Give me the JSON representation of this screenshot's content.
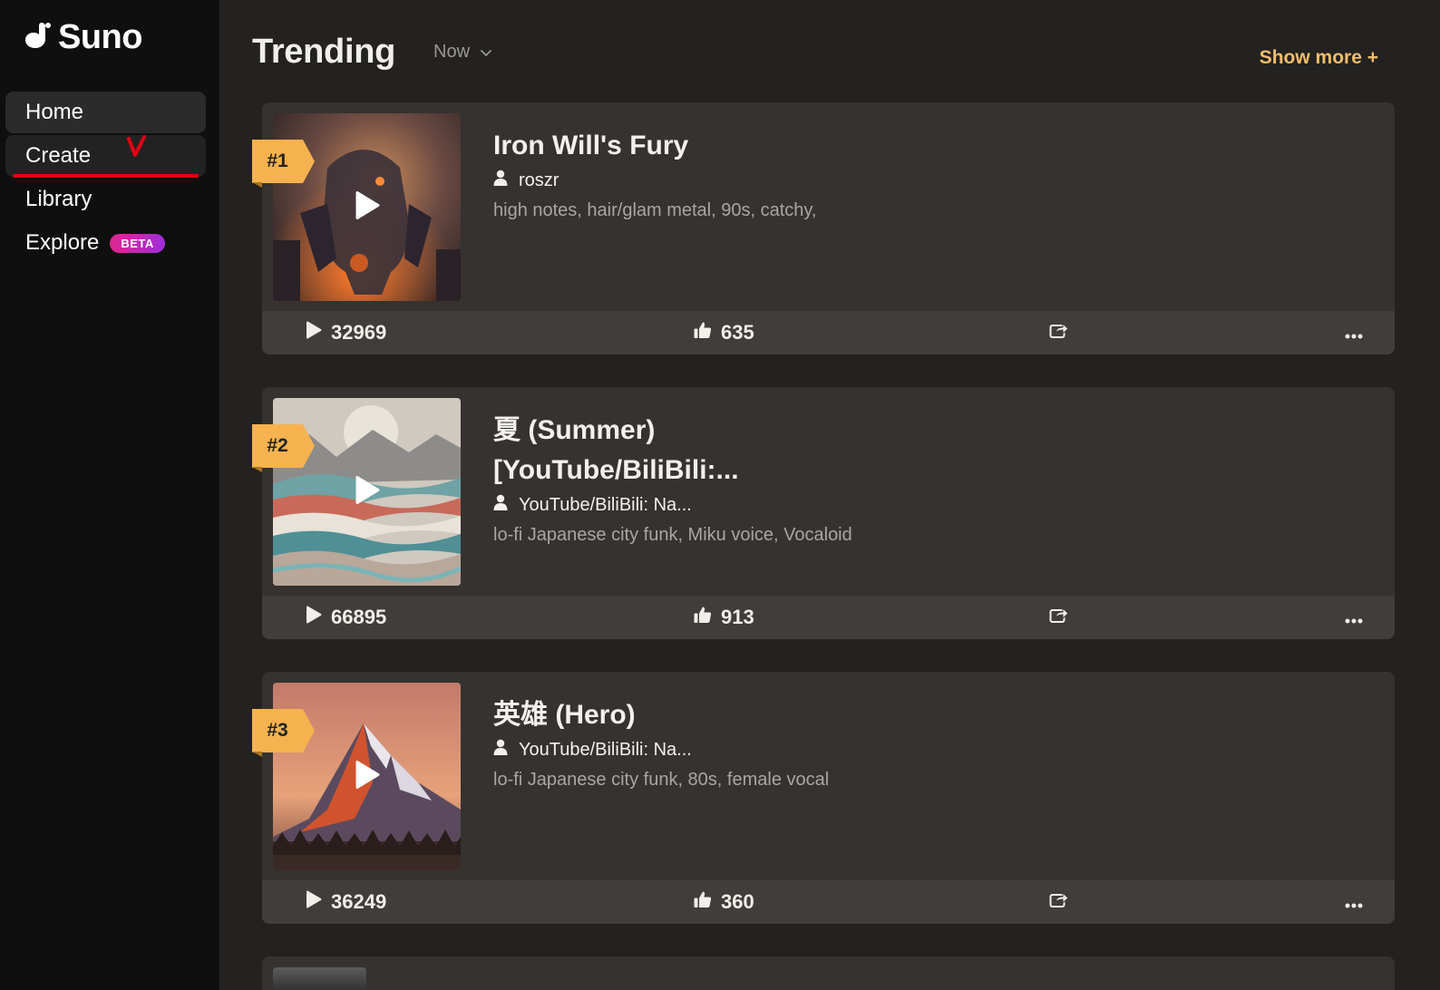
{
  "brand": {
    "name": "Suno"
  },
  "sidebar": {
    "items": [
      {
        "label": "Home"
      },
      {
        "label": "Create"
      },
      {
        "label": "Library"
      },
      {
        "label": "Explore",
        "badge": "BETA"
      }
    ]
  },
  "trending": {
    "title": "Trending",
    "filter": "Now",
    "show_more": "Show more +"
  },
  "songs": [
    {
      "rank": "#1",
      "title": "Iron Will's Fury",
      "author": "roszr",
      "tags": "high notes, hair/glam metal, 90s, catchy,",
      "plays": "32969",
      "likes": "635"
    },
    {
      "rank": "#2",
      "title": "夏 (Summer) [YouTube/BiliBili:...",
      "author": "YouTube/BiliBili: Na...",
      "tags": "lo-fi Japanese city funk, Miku voice, Vocaloid",
      "plays": "66895",
      "likes": "913"
    },
    {
      "rank": "#3",
      "title": "英雄 (Hero)",
      "author": "YouTube/BiliBili: Na...",
      "tags": "lo-fi Japanese city funk, 80s, female vocal",
      "plays": "36249",
      "likes": "360"
    }
  ]
}
